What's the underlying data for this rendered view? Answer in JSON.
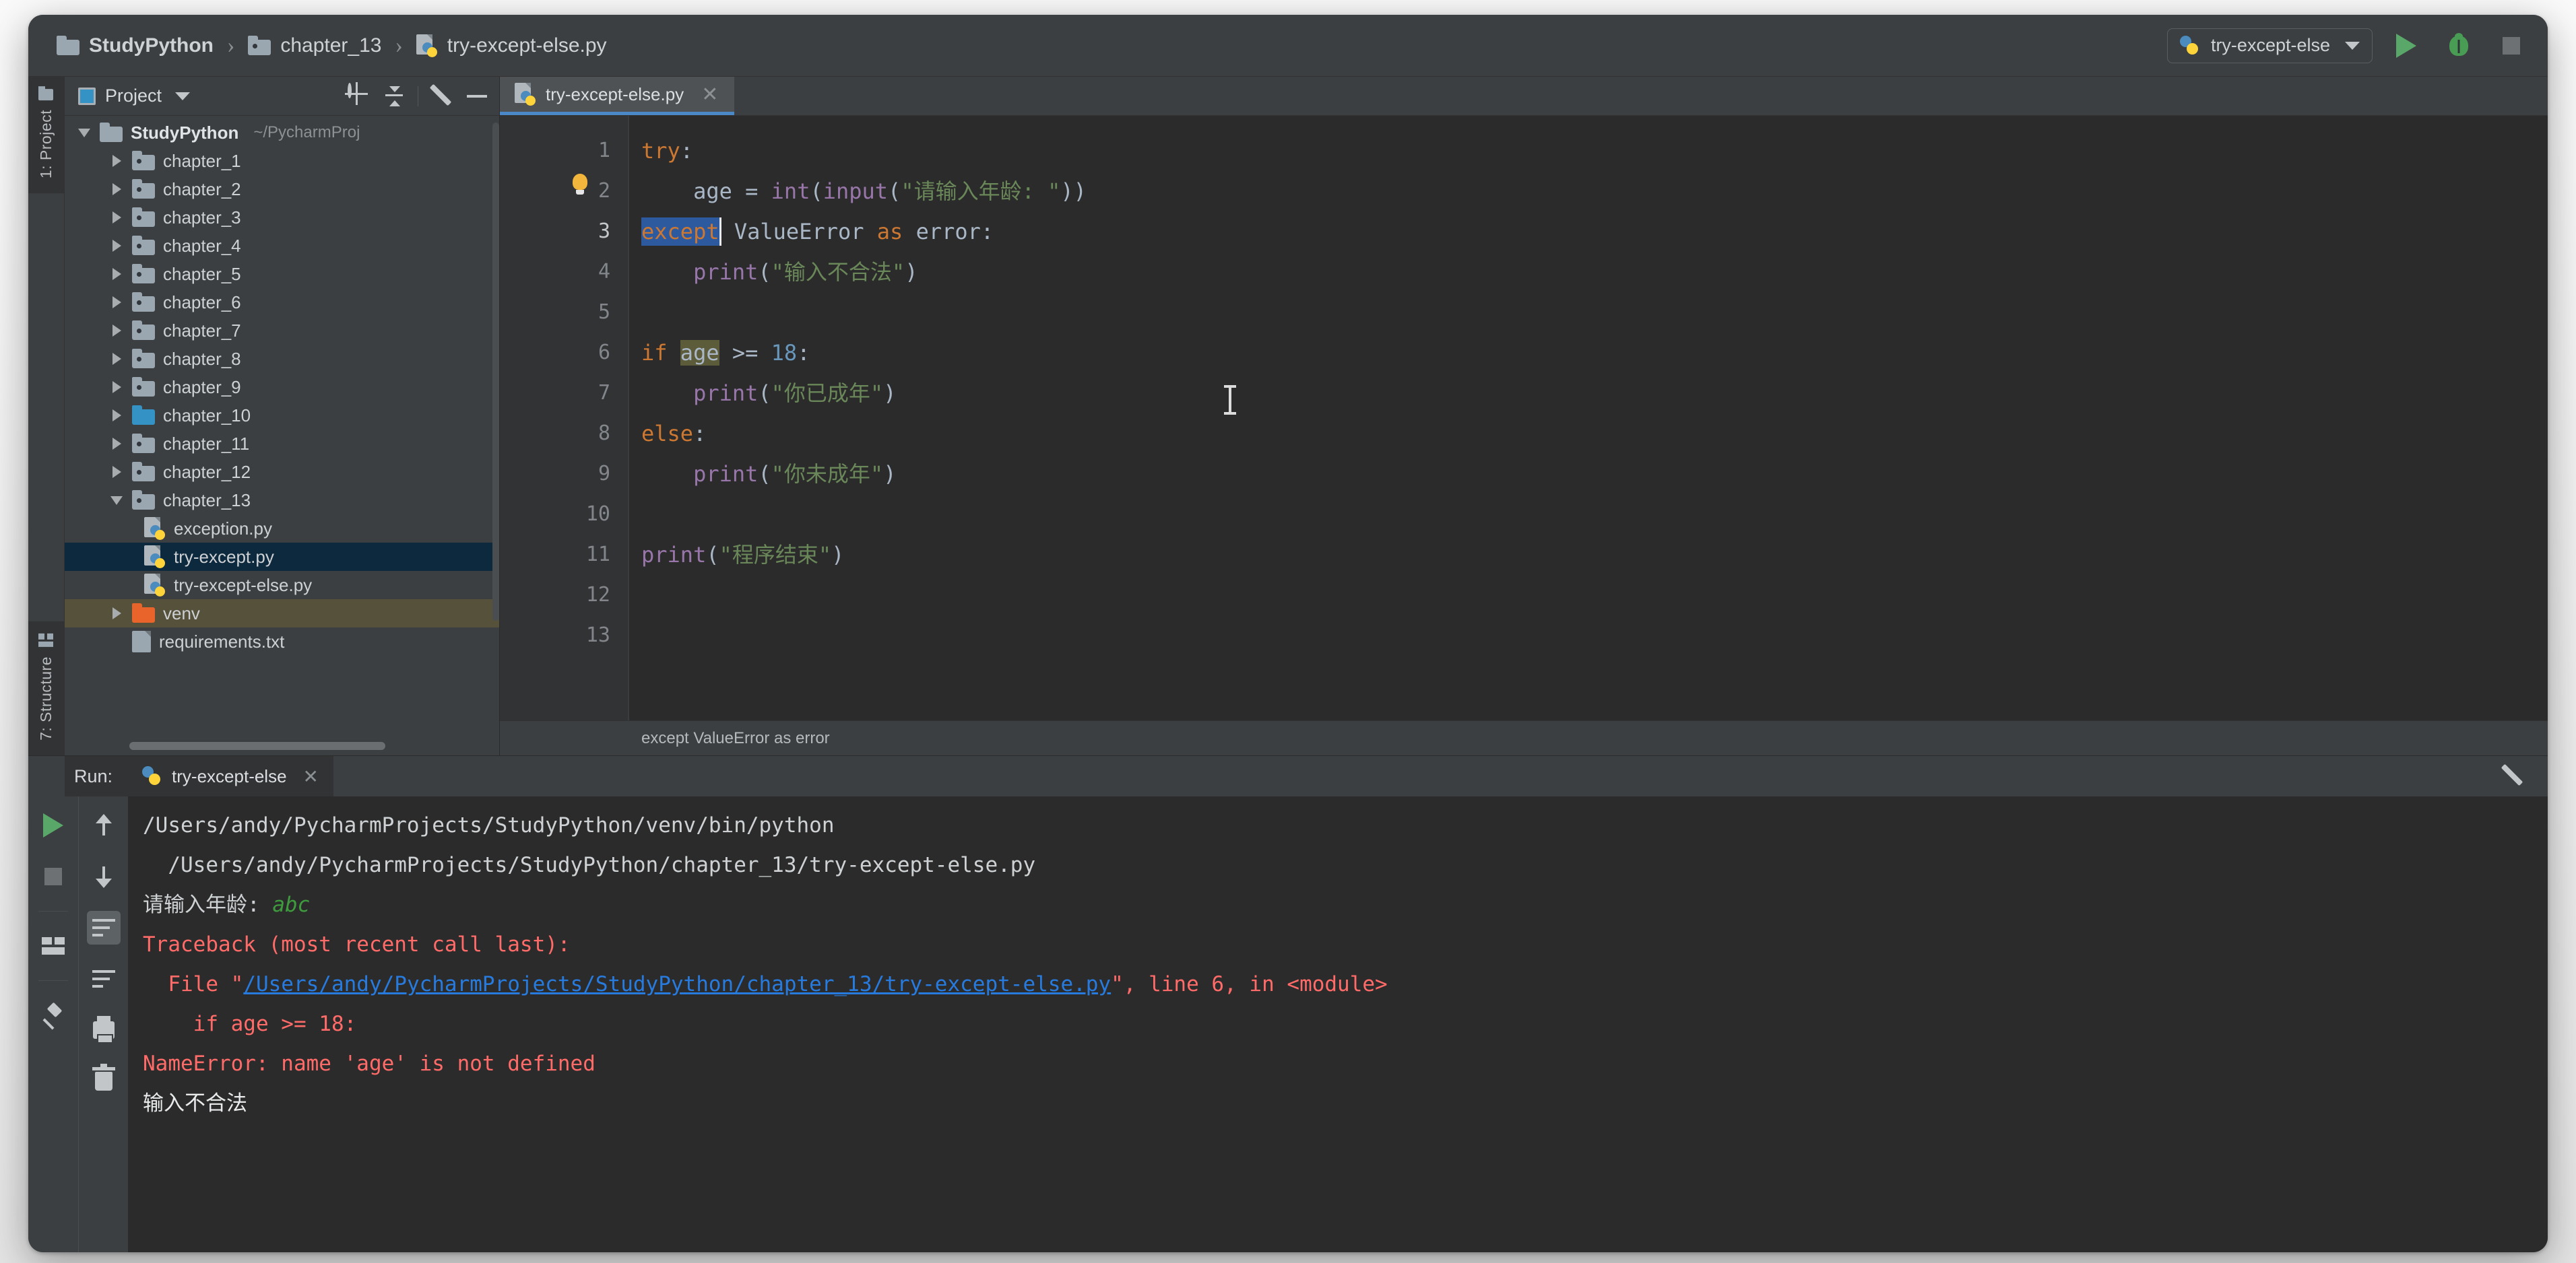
{
  "window": {
    "breadcrumb": [
      {
        "icon": "folder-icon",
        "label": "StudyPython"
      },
      {
        "icon": "folder-icon",
        "label": "chapter_13"
      },
      {
        "icon": "python-file-icon",
        "label": "try-except-else.py"
      }
    ],
    "separator": "›"
  },
  "toolbar": {
    "run_config": "try-except-else",
    "run_config_icon": "python-icon",
    "dropdown_icon": "chevron-down-icon",
    "run_icon": "run-play-icon",
    "debug_icon": "debug-bug-icon",
    "stop_icon": "stop-square-icon"
  },
  "tool_windows": {
    "left_top": "1: Project",
    "left_bottom": "7: Structure"
  },
  "project_panel": {
    "title": "Project",
    "title_icon": "project-view-icon",
    "dropdown_icon": "chevron-down-icon",
    "icons": [
      "locate-target-icon",
      "collapse-all-icon",
      "gear-icon",
      "hide-minus-icon"
    ],
    "tree": [
      {
        "depth": 1,
        "arrow": "down",
        "icon": "folder-icon",
        "label": "StudyPython",
        "bold": true,
        "hint": "~/PycharmProj",
        "state": "normal"
      },
      {
        "depth": 2,
        "arrow": "right",
        "icon": "folder-dot-icon",
        "label": "chapter_1",
        "state": "normal"
      },
      {
        "depth": 2,
        "arrow": "right",
        "icon": "folder-dot-icon",
        "label": "chapter_2",
        "state": "normal"
      },
      {
        "depth": 2,
        "arrow": "right",
        "icon": "folder-dot-icon",
        "label": "chapter_3",
        "state": "normal"
      },
      {
        "depth": 2,
        "arrow": "right",
        "icon": "folder-dot-icon",
        "label": "chapter_4",
        "state": "normal"
      },
      {
        "depth": 2,
        "arrow": "right",
        "icon": "folder-dot-icon",
        "label": "chapter_5",
        "state": "normal"
      },
      {
        "depth": 2,
        "arrow": "right",
        "icon": "folder-dot-icon",
        "label": "chapter_6",
        "state": "normal"
      },
      {
        "depth": 2,
        "arrow": "right",
        "icon": "folder-dot-icon",
        "label": "chapter_7",
        "state": "normal"
      },
      {
        "depth": 2,
        "arrow": "right",
        "icon": "folder-dot-icon",
        "label": "chapter_8",
        "state": "normal"
      },
      {
        "depth": 2,
        "arrow": "right",
        "icon": "folder-dot-icon",
        "label": "chapter_9",
        "state": "normal"
      },
      {
        "depth": 2,
        "arrow": "right",
        "icon": "folder-source-icon",
        "label": "chapter_10",
        "state": "normal"
      },
      {
        "depth": 2,
        "arrow": "right",
        "icon": "folder-dot-icon",
        "label": "chapter_11",
        "state": "normal"
      },
      {
        "depth": 2,
        "arrow": "right",
        "icon": "folder-dot-icon",
        "label": "chapter_12",
        "state": "normal"
      },
      {
        "depth": 2,
        "arrow": "down",
        "icon": "folder-dot-icon",
        "label": "chapter_13",
        "state": "normal"
      },
      {
        "depth": 3,
        "arrow": "none",
        "icon": "python-file-icon",
        "label": "exception.py",
        "state": "normal"
      },
      {
        "depth": 3,
        "arrow": "none",
        "icon": "python-file-icon",
        "label": "try-except.py",
        "state": "selected"
      },
      {
        "depth": 3,
        "arrow": "none",
        "icon": "python-file-icon",
        "label": "try-except-else.py",
        "state": "normal"
      },
      {
        "depth": 2,
        "arrow": "right",
        "icon": "folder-excluded-icon",
        "label": "venv",
        "state": "venv"
      },
      {
        "depth": 2,
        "arrow": "none",
        "icon": "text-file-icon",
        "label": "requirements.txt",
        "state": "normal"
      }
    ]
  },
  "editor": {
    "tab": {
      "label": "try-except-else.py",
      "icon": "python-file-icon",
      "close_icon": "close-icon"
    },
    "gutter_lines": [
      "1",
      "2",
      "3",
      "4",
      "5",
      "6",
      "7",
      "8",
      "9",
      "10",
      "11",
      "12",
      "13"
    ],
    "current_line": "3",
    "inspection_icon": "lightbulb-icon",
    "status_breadcrumb": "except ValueError as error",
    "code_lines": [
      {
        "n": "1",
        "text": "try:"
      },
      {
        "n": "2",
        "text": "    age = int(input(\"请输入年龄: \"))"
      },
      {
        "n": "3",
        "text": "except ValueError as error:"
      },
      {
        "n": "4",
        "text": "    print(\"输入不合法\")"
      },
      {
        "n": "5",
        "text": ""
      },
      {
        "n": "6",
        "text": "if age >= 18:"
      },
      {
        "n": "7",
        "text": "    print(\"你已成年\")"
      },
      {
        "n": "8",
        "text": "else:"
      },
      {
        "n": "9",
        "text": "    print(\"你未成年\")"
      },
      {
        "n": "10",
        "text": ""
      },
      {
        "n": "11",
        "text": "print(\"程序结束\")"
      },
      {
        "n": "12",
        "text": ""
      },
      {
        "n": "13",
        "text": ""
      }
    ],
    "tokens": {
      "l1_kw": "try",
      "l1_colon": ":",
      "l2_name": "age",
      "l2_eq": " = ",
      "l2_int": "int",
      "l2_p1": "(",
      "l2_input": "input",
      "l2_p2": "(",
      "l2_str": "\"请输入年龄: \"",
      "l2_close": "))",
      "l3_kw": "except",
      "l3_exc": " ValueError ",
      "l3_as": "as",
      "l3_var": " error:",
      "l4_fn": "print",
      "l4_open": "(",
      "l4_str": "\"输入不合法\"",
      "l4_close": ")",
      "l6_if": "if",
      "l6_sp": " ",
      "l6_var": "age",
      "l6_op": " >= ",
      "l6_num": "18",
      "l6_colon": ":",
      "l7_fn": "print",
      "l7_open": "(",
      "l7_str": "\"你已成年\"",
      "l7_close": ")",
      "l8_else": "else",
      "l8_colon": ":",
      "l9_fn": "print",
      "l9_open": "(",
      "l9_str": "\"你未成年\"",
      "l9_close": ")",
      "l11_fn": "print",
      "l11_open": "(",
      "l11_str": "\"程序结束\"",
      "l11_close": ")"
    }
  },
  "run_panel": {
    "label": "Run:",
    "tab": {
      "label": "try-except-else",
      "icon": "python-icon",
      "close_icon": "close-icon"
    },
    "gear_icon": "gear-icon",
    "left_buttons": [
      "rerun-play-icon",
      "stop-square-icon",
      "layout-icon",
      "pin-icon"
    ],
    "right_buttons": [
      "arrow-up-icon",
      "arrow-down-icon",
      "soft-wrap-icon",
      "scroll-to-end-icon",
      "print-icon",
      "clear-all-icon"
    ],
    "active_button": "soft-wrap-icon",
    "console": [
      {
        "kind": "plain",
        "text": "/Users/andy/PycharmProjects/StudyPython/venv/bin/python"
      },
      {
        "kind": "plain",
        "text": "  /Users/andy/PycharmProjects/StudyPython/chapter_13/try-except-else.py"
      },
      {
        "kind": "prompt",
        "prompt": "请输入年龄: ",
        "input": "abc"
      },
      {
        "kind": "error",
        "text": "Traceback (most recent call last):"
      },
      {
        "kind": "error_link",
        "pre": "  File \"",
        "link": "/Users/andy/PycharmProjects/StudyPython/chapter_13/try-except-else.py",
        "post": "\", line 6, in <module>"
      },
      {
        "kind": "error",
        "text": "    if age >= 18:"
      },
      {
        "kind": "error",
        "text": "NameError: name 'age' is not defined"
      },
      {
        "kind": "white",
        "text": "输入不合法"
      }
    ]
  },
  "colors": {
    "accent_blue": "#4a88c7",
    "keyword_orange": "#cc7832",
    "string_green": "#6a8759",
    "function_purple": "#9876aa",
    "number_blue": "#6897bb",
    "error_red": "#ff6b68",
    "link_blue": "#287bde",
    "selection_blue": "#2d5a9e",
    "usage_olive": "#5c5b3a",
    "run_green": "#59a869",
    "panel_bg": "#3c3f41",
    "editor_bg": "#2b2b2b"
  }
}
